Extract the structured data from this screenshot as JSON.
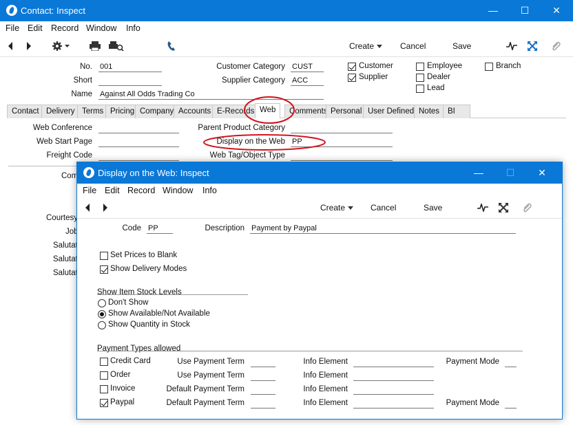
{
  "main_window": {
    "title": "Contact: Inspect",
    "menu": [
      "File",
      "Edit",
      "Record",
      "Window",
      "Info"
    ],
    "toolbar": {
      "create": "Create",
      "cancel": "Cancel",
      "save": "Save"
    },
    "header": {
      "no_label": "No.",
      "no_value": "001",
      "short_label": "Short",
      "short_value": "",
      "name_label": "Name",
      "name_value": "Against All Odds Trading Co",
      "cust_cat_label": "Customer Category",
      "cust_cat_value": "CUST",
      "supp_cat_label": "Supplier Category",
      "supp_cat_value": "ACC",
      "checkboxes": [
        {
          "label": "Customer",
          "checked": true
        },
        {
          "label": "Supplier",
          "checked": true
        },
        {
          "label": "Employee",
          "checked": false
        },
        {
          "label": "Dealer",
          "checked": false
        },
        {
          "label": "Lead",
          "checked": false
        },
        {
          "label": "Branch",
          "checked": false
        }
      ]
    },
    "tabs": [
      "Contact",
      "Delivery",
      "Terms",
      "Pricing",
      "Company",
      "Accounts",
      "E-Records",
      "Web",
      "Comments",
      "Personal",
      "User Defined",
      "Notes",
      "BI"
    ],
    "active_tab": "Web",
    "web": {
      "web_conference": "Web Conference",
      "web_start_page": "Web Start Page",
      "freight_code": "Freight Code",
      "parent_product_category": "Parent Product Category",
      "display_on_web_label": "Display on the Web",
      "display_on_web_value": "PP",
      "web_tag": "Web Tag/Object Type"
    },
    "partial_labels": [
      "Com",
      "Courtesy",
      "Job",
      "Salutat",
      "Salutat",
      "Salutat"
    ]
  },
  "dialog": {
    "title": "Display on the Web: Inspect",
    "menu": [
      "File",
      "Edit",
      "Record",
      "Window",
      "Info"
    ],
    "toolbar": {
      "create": "Create",
      "cancel": "Cancel",
      "save": "Save"
    },
    "code_label": "Code",
    "code_value": "PP",
    "desc_label": "Description",
    "desc_value": "Payment by Paypal",
    "set_prices_blank": {
      "label": "Set Prices to Blank",
      "checked": false
    },
    "show_delivery_modes": {
      "label": "Show Delivery Modes",
      "checked": true
    },
    "stock_levels": {
      "heading": "Show Item Stock Levels",
      "options": [
        {
          "label": "Don't Show",
          "selected": false
        },
        {
          "label": "Show Available/Not Available",
          "selected": true
        },
        {
          "label": "Show Quantity in Stock",
          "selected": false
        }
      ]
    },
    "payment_types": {
      "heading": "Payment Types allowed",
      "rows": [
        {
          "label": "Credit Card",
          "checked": false,
          "term_label": "Use Payment Term",
          "info_label": "Info Element",
          "mode_label": "Payment Mode"
        },
        {
          "label": "Order",
          "checked": false,
          "term_label": "Use Payment Term",
          "info_label": "Info Element",
          "mode_label": ""
        },
        {
          "label": "Invoice",
          "checked": false,
          "term_label": "Default Payment Term",
          "info_label": "Info Element",
          "mode_label": ""
        },
        {
          "label": "Paypal",
          "checked": true,
          "term_label": "Default Payment Term",
          "info_label": "Info Element",
          "mode_label": "Payment Mode"
        }
      ]
    }
  },
  "colors": {
    "titlebar": "#0a78d7",
    "highlight_circle": "#d0141e"
  }
}
